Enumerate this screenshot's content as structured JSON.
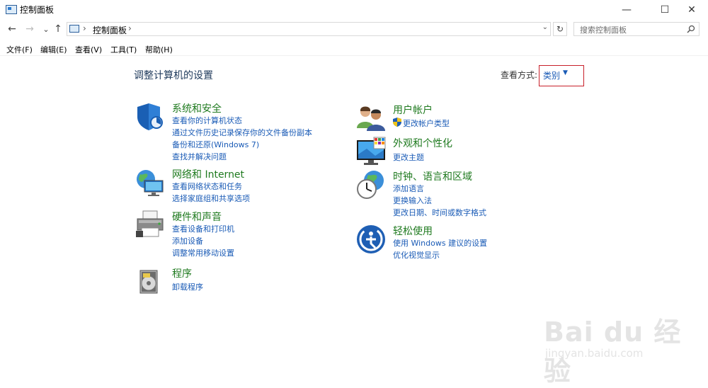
{
  "window": {
    "title": "控制面板",
    "minimize": "—",
    "maximize": "☐",
    "close": "✕"
  },
  "nav": {
    "back": "←",
    "forward": "→",
    "recent": "⌄",
    "up": "↑"
  },
  "address": {
    "sep": "›",
    "crumb": "控制面板",
    "dropdown": "⌄",
    "refresh": "↻"
  },
  "search": {
    "placeholder": "搜索控制面板"
  },
  "menu": [
    "文件(F)",
    "编辑(E)",
    "查看(V)",
    "工具(T)",
    "帮助(H)"
  ],
  "main": {
    "title": "调整计算机的设置"
  },
  "view_by": {
    "label": "查看方式:",
    "value": "类别",
    "caret": "▼"
  },
  "categories": {
    "system": {
      "title": "系统和安全",
      "links": [
        "查看你的计算机状态",
        "通过文件历史记录保存你的文件备份副本",
        "备份和还原(Windows 7)",
        "查找并解决问题"
      ],
      "icon": "shield-icon"
    },
    "network": {
      "title": "网络和 Internet",
      "links": [
        "查看网络状态和任务",
        "选择家庭组和共享选项"
      ],
      "icon": "network-globe-icon"
    },
    "hardware": {
      "title": "硬件和声音",
      "links": [
        "查看设备和打印机",
        "添加设备",
        "调整常用移动设置"
      ],
      "icon": "printer-icon"
    },
    "programs": {
      "title": "程序",
      "links": [
        "卸载程序"
      ],
      "icon": "programs-disc-icon"
    },
    "users": {
      "title": "用户帐户",
      "links": [
        "更改帐户类型"
      ],
      "icon": "users-icon"
    },
    "appearance": {
      "title": "外观和个性化",
      "links": [
        "更改主题"
      ],
      "icon": "monitor-palette-icon"
    },
    "clock": {
      "title": "时钟、语言和区域",
      "links": [
        "添加语言",
        "更换输入法",
        "更改日期、时间或数字格式"
      ],
      "icon": "clock-globe-icon"
    },
    "ease": {
      "title": "轻松使用",
      "links": [
        "使用 Windows 建议的设置",
        "优化视觉显示"
      ],
      "icon": "ease-of-access-icon"
    }
  },
  "watermark": {
    "brand": "Bai du 经验",
    "url": "jingyan.baidu.com"
  },
  "colors": {
    "link": "#1a5bb6",
    "category_title": "#1f7a1f",
    "highlight_box": "#c8202a"
  }
}
